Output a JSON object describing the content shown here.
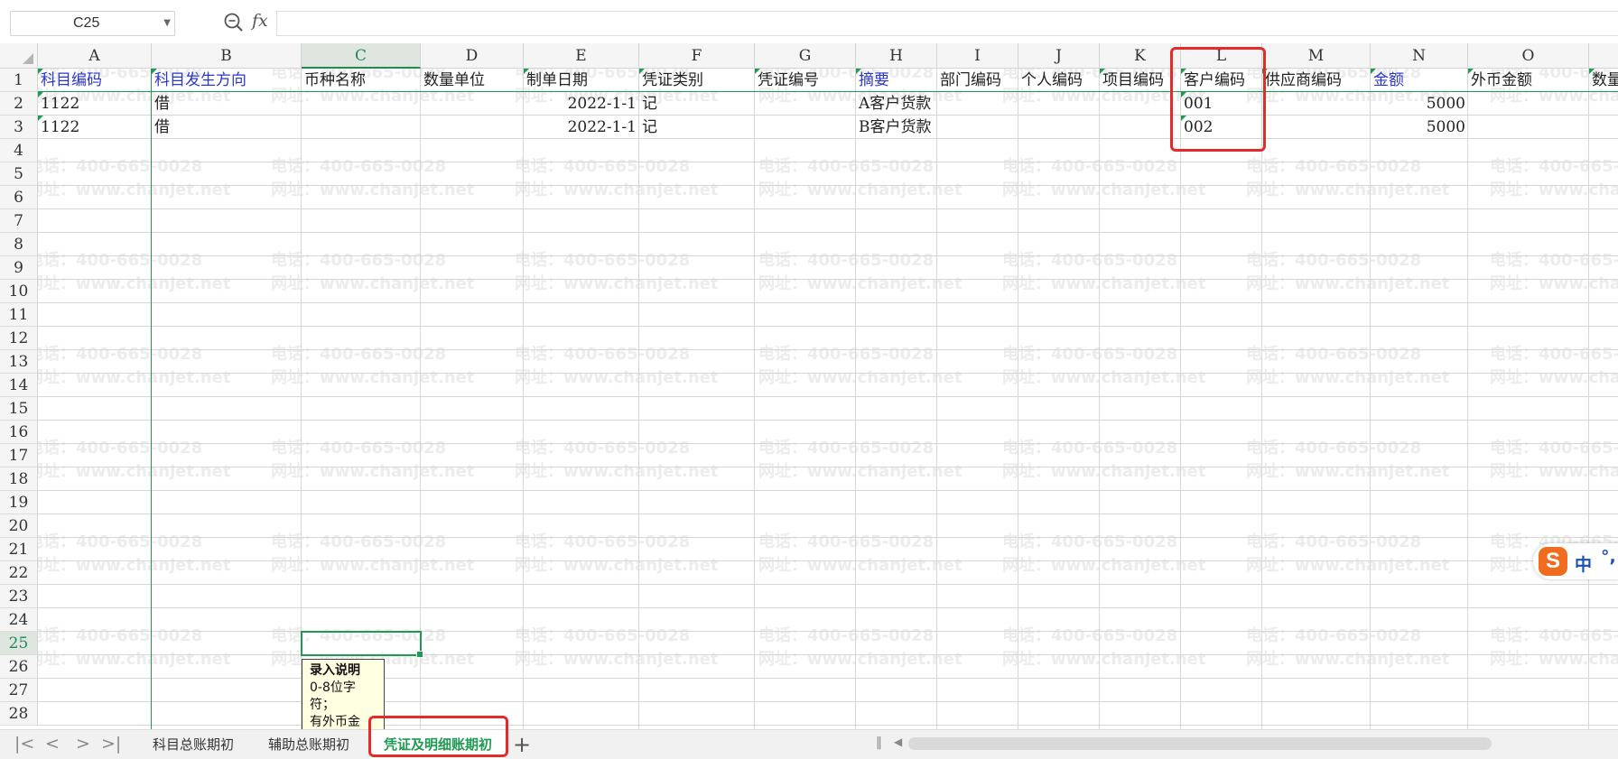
{
  "formula_bar": {
    "cell_ref": "C25",
    "fx_label": "fx",
    "formula": ""
  },
  "columns": [
    "A",
    "B",
    "C",
    "D",
    "E",
    "F",
    "G",
    "H",
    "I",
    "J",
    "K",
    "L",
    "M",
    "N",
    "O"
  ],
  "selected_column": "C",
  "rows": [
    "1",
    "2",
    "3",
    "4",
    "5",
    "6",
    "7",
    "8",
    "9",
    "10",
    "11",
    "12",
    "13",
    "14",
    "15",
    "16",
    "17",
    "18",
    "19",
    "20",
    "21",
    "22",
    "23",
    "24",
    "25",
    "26",
    "27",
    "28"
  ],
  "selected_row": "25",
  "header_row": [
    "科目编码",
    "科目发生方向",
    "币种名称",
    "数量单位",
    "制单日期",
    "凭证类别",
    "凭证编号",
    "摘要",
    "部门编码",
    "个人编码",
    "项目编码",
    "客户编码",
    "供应商编码",
    "金额",
    "外币金额",
    "数量"
  ],
  "data_rows": [
    [
      "1122",
      "借",
      "",
      "",
      "2022-1-1",
      "记",
      "",
      "A客户货款",
      "",
      "",
      "",
      "001",
      "",
      "5000",
      "",
      ""
    ],
    [
      "1122",
      "借",
      "",
      "",
      "2022-1-1",
      "记",
      "",
      "B客户货款",
      "",
      "",
      "",
      "002",
      "",
      "5000",
      "",
      ""
    ]
  ],
  "watermark": {
    "phone": "电话：400-665-0028",
    "site": "网址：www.chanjet.net"
  },
  "tooltip": {
    "title": "录入说明",
    "lines": [
      "0-8位字",
      "符；",
      "有外币金"
    ]
  },
  "ime": {
    "logo": "S",
    "lang": "中",
    "punct": "°,"
  },
  "sheet_tabs": [
    {
      "label": "科目总账期初",
      "active": false
    },
    {
      "label": "辅助总账期初",
      "active": false
    },
    {
      "label": "凭证及明细账期初",
      "active": true
    }
  ],
  "add_tab": "+",
  "colors": {
    "accent": "#1f9a53",
    "header_blue": "#2b37c7",
    "annotation_red": "#e22b2b"
  }
}
